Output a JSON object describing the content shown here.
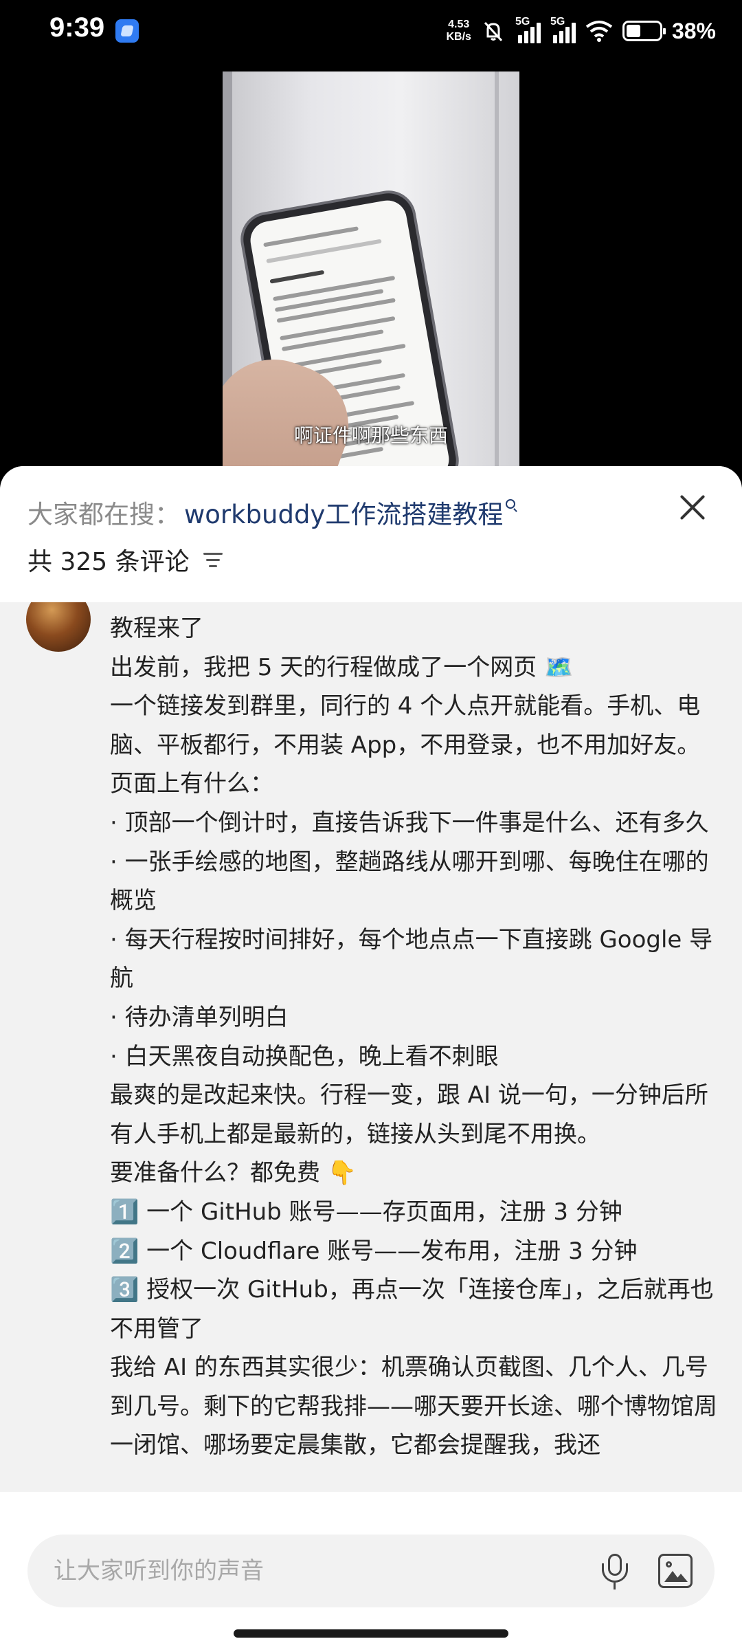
{
  "status_bar": {
    "time": "9:39",
    "net_speed_value": "4.53",
    "net_speed_unit": "KB/s",
    "sim1_label": "5G",
    "sim2_label": "5G",
    "battery_percent": "38%",
    "icons": [
      "app-notification-icon",
      "mute-bell-icon",
      "signal-icon",
      "wifi-icon",
      "battery-icon"
    ]
  },
  "video": {
    "subtitle": "啊证件啊那些东西"
  },
  "comments_panel": {
    "hot_search_prefix": "大家都在搜：",
    "hot_search_term": "workbuddy工作流搭建教程",
    "count_label": "共 325 条评论",
    "comment_lines": [
      "教程来了",
      "出发前，我把 5 天的行程做成了一个网页 🗺️",
      "一个链接发到群里，同行的 4 个人点开就能看。手机、电脑、平板都行，不用装 App，不用登录，也不用加好友。",
      "页面上有什么：",
      "· 顶部一个倒计时，直接告诉我下一件事是什么、还有多久",
      "· 一张手绘感的地图，整趟路线从哪开到哪、每晚住在哪的概览",
      "· 每天行程按时间排好，每个地点点一下直接跳 Google 导航",
      "· 待办清单列明白",
      "· 白天黑夜自动换配色，晚上看不刺眼",
      "最爽的是改起来快。行程一变，跟 AI 说一句，一分钟后所有人手机上都是最新的，链接从头到尾不用换。",
      "要准备什么？都免费 👇",
      "1️⃣ 一个 GitHub 账号——存页面用，注册 3 分钟",
      "2️⃣ 一个 Cloudflare 账号——发布用，注册 3 分钟",
      "3️⃣ 授权一次 GitHub，再点一次「连接仓库」，之后就再也不用管了",
      "我给 AI 的东西其实很少：机票确认页截图、几个人、几号到几号。剩下的它帮我排——哪天要开长途、哪个博物馆周一闭馆、哪场要定晨集散，它都会提醒我，我还"
    ]
  },
  "input": {
    "placeholder": "让大家听到你的声音"
  },
  "colors": {
    "accent_link": "#1f3a6e",
    "panel_bg": "#f2f2f2",
    "header_bg": "#ffffff"
  }
}
